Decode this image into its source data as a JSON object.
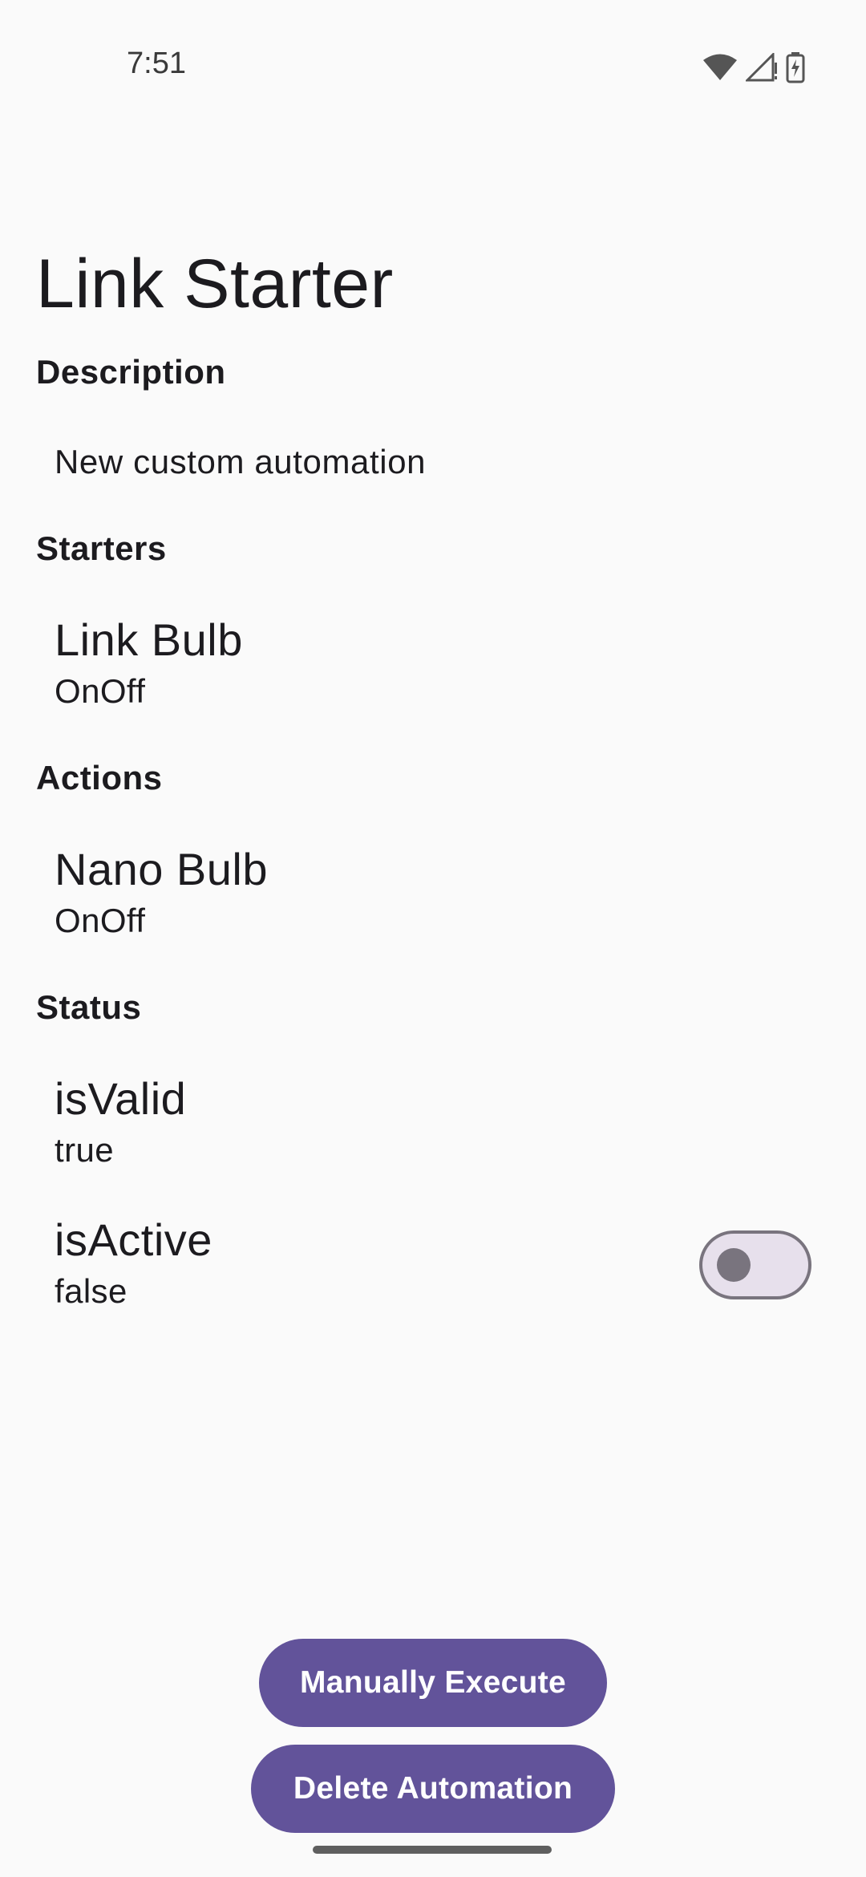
{
  "status_bar": {
    "time": "7:51",
    "icons": [
      "wifi-icon",
      "signal-icon",
      "battery-charging-icon"
    ]
  },
  "page": {
    "title": "Link Starter"
  },
  "description": {
    "label": "Description",
    "value": "New custom automation"
  },
  "starters": {
    "label": "Starters",
    "items": [
      {
        "name": "Link Bulb",
        "trait": "OnOff"
      }
    ]
  },
  "actions": {
    "label": "Actions",
    "items": [
      {
        "name": "Nano Bulb",
        "trait": "OnOff"
      }
    ]
  },
  "status": {
    "label": "Status",
    "is_valid": {
      "name": "isValid",
      "value": "true"
    },
    "is_active": {
      "name": "isActive",
      "value": "false",
      "toggle_on": false
    }
  },
  "buttons": {
    "execute_label": "Manually Execute",
    "delete_label": "Delete Automation"
  },
  "colors": {
    "accent": "#62539a",
    "background": "#fafafa",
    "toggle_track": "#e7e0ec",
    "toggle_outline": "#79747e"
  }
}
